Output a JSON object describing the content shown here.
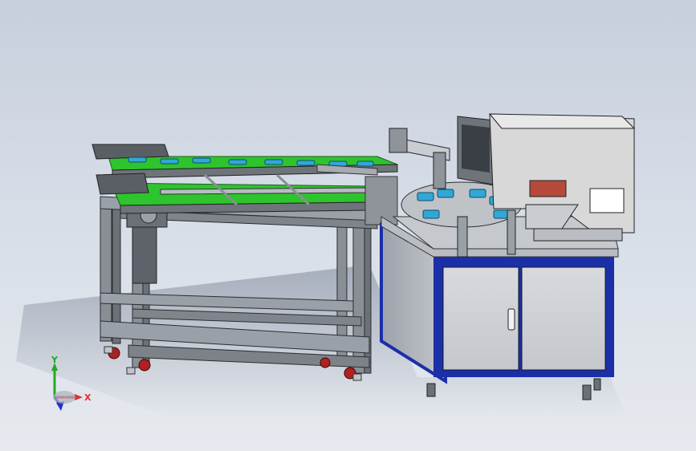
{
  "viewport": {
    "description_name": "cad-3d-viewport"
  },
  "triad": {
    "x_label": "X",
    "y_label": "Y",
    "x_color": "#e03030",
    "y_color": "#22aa22",
    "z_color": "#2233cc"
  },
  "colors": {
    "conveyor_belt": "#2ec42e",
    "frame_aluminum": "#8a8f96",
    "cabinet_body": "#c9ccd1",
    "cabinet_trim": "#1a2fa8",
    "part_blue": "#2fa8d8",
    "caster_red": "#b02020",
    "printer_body": "#d8d8d8"
  }
}
